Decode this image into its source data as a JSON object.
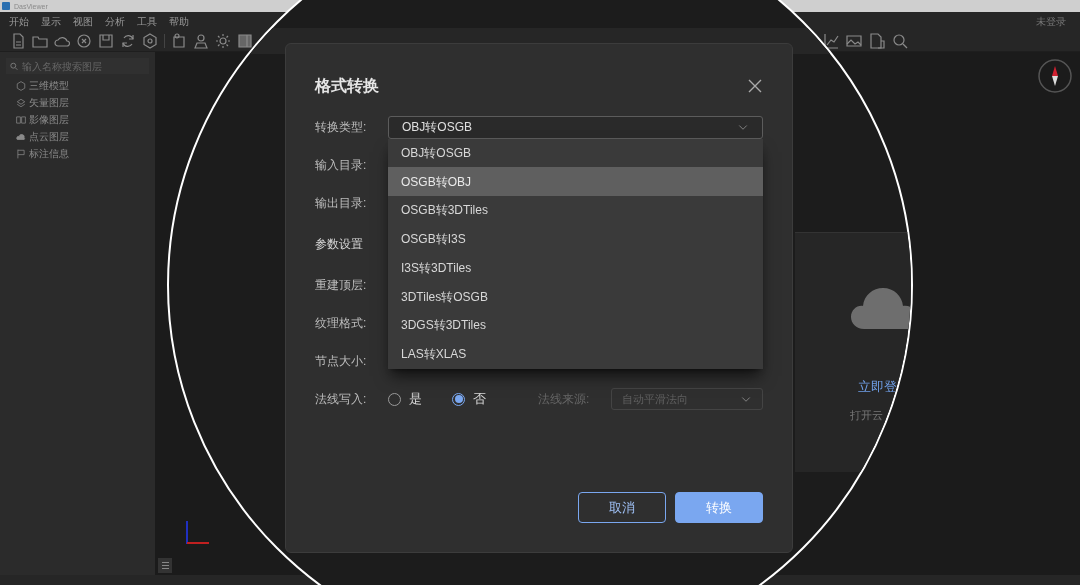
{
  "window": {
    "title": "DasViewer",
    "account": "未登录"
  },
  "menu": [
    "开始",
    "显示",
    "视图",
    "分析",
    "工具",
    "帮助"
  ],
  "sidebar": {
    "search_placeholder": "输入名称搜索图层",
    "items": [
      {
        "label": "三维模型"
      },
      {
        "label": "矢量图层"
      },
      {
        "label": "影像图层"
      },
      {
        "label": "点云图层"
      },
      {
        "label": "标注信息"
      }
    ]
  },
  "dialog": {
    "title": "格式转换",
    "rows": [
      {
        "kind": "select",
        "label": "转换类型:",
        "value": "OBJ转OSGB",
        "expanded": true,
        "options": [
          {
            "label": "OBJ转OSGB",
            "highlighted": false
          },
          {
            "label": "OSGB转OBJ",
            "highlighted": true
          },
          {
            "label": "OSGB转3DTiles",
            "highlighted": false
          },
          {
            "label": "OSGB转I3S",
            "highlighted": false
          },
          {
            "label": "I3S转3DTiles",
            "highlighted": false
          },
          {
            "label": "3DTiles转OSGB",
            "highlighted": false
          },
          {
            "label": "3DGS转3DTiles",
            "highlighted": false
          },
          {
            "label": "LAS转XLAS",
            "highlighted": false
          }
        ]
      },
      {
        "kind": "label",
        "label": "输入目录:"
      },
      {
        "kind": "label",
        "label": "输出目录:"
      },
      {
        "kind": "section",
        "label": "参数设置"
      },
      {
        "kind": "label",
        "label": "重建顶层:"
      },
      {
        "kind": "label",
        "label": "纹理格式:"
      },
      {
        "kind": "label",
        "label": "节点大小:"
      },
      {
        "kind": "radio",
        "label": "法线写入:",
        "options": [
          {
            "label": "是",
            "selected": false
          },
          {
            "label": "否",
            "selected": true
          }
        ],
        "secondary": {
          "label": "法线来源:",
          "value": "自动平滑法向",
          "disabled": true
        }
      }
    ],
    "buttons": [
      {
        "kind": "secondary",
        "label": "取消"
      },
      {
        "kind": "primary",
        "label": "转换"
      }
    ]
  },
  "login_panel": {
    "link": "立即登",
    "hint": "打开云"
  }
}
